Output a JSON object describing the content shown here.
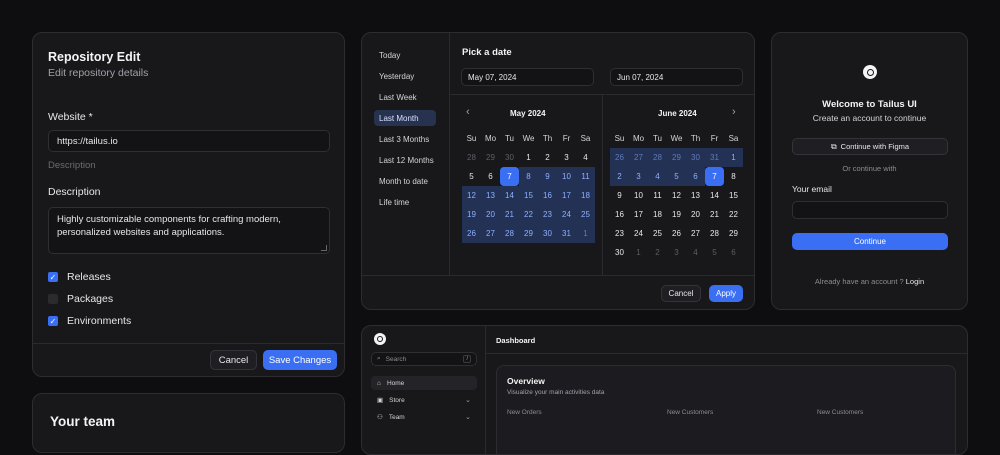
{
  "repo": {
    "title": "Repository Edit",
    "subtitle": "Edit repository details",
    "website_label": "Website *",
    "website_value": "https://tailus.io",
    "website_hint": "Description",
    "description_label": "Description",
    "description_value": "Highly customizable components for crafting modern, personalized websites and applications.",
    "checks": [
      {
        "label": "Releases",
        "checked": true
      },
      {
        "label": "Packages",
        "checked": false
      },
      {
        "label": "Environments",
        "checked": true
      }
    ],
    "cancel_label": "Cancel",
    "save_label": "Save Changes"
  },
  "team": {
    "title": "Your team"
  },
  "datepicker": {
    "presets": [
      "Today",
      "Yesterday",
      "Last Week",
      "Last Month",
      "Last 3 Months",
      "Last 12 Months",
      "Month to date",
      "Life time"
    ],
    "active_preset": "Last Month",
    "title": "Pick a date",
    "start_date": "May 07, 2024",
    "end_date": "Jun 07, 2024",
    "weekdays": [
      "Su",
      "Mo",
      "Tu",
      "We",
      "Th",
      "Fr",
      "Sa"
    ],
    "months": [
      {
        "name": "May 2024",
        "weeks": [
          [
            [
              "28",
              "o"
            ],
            [
              "29",
              "o"
            ],
            [
              "30",
              "o"
            ],
            [
              "1",
              ""
            ],
            [
              "2",
              ""
            ],
            [
              "3",
              ""
            ],
            [
              "4",
              ""
            ]
          ],
          [
            [
              "5",
              ""
            ],
            [
              "6",
              ""
            ],
            [
              "7",
              "s"
            ],
            [
              "8",
              "r"
            ],
            [
              "9",
              "r"
            ],
            [
              "10",
              "r"
            ],
            [
              "11",
              "r"
            ]
          ],
          [
            [
              "12",
              "r"
            ],
            [
              "13",
              "r"
            ],
            [
              "14",
              "r"
            ],
            [
              "15",
              "r"
            ],
            [
              "16",
              "r"
            ],
            [
              "17",
              "r"
            ],
            [
              "18",
              "r"
            ]
          ],
          [
            [
              "19",
              "r"
            ],
            [
              "20",
              "r"
            ],
            [
              "21",
              "r"
            ],
            [
              "22",
              "r"
            ],
            [
              "23",
              "r"
            ],
            [
              "24",
              "r"
            ],
            [
              "25",
              "r"
            ]
          ],
          [
            [
              "26",
              "r"
            ],
            [
              "27",
              "r"
            ],
            [
              "28",
              "r"
            ],
            [
              "29",
              "r"
            ],
            [
              "30",
              "r"
            ],
            [
              "31",
              "r"
            ],
            [
              "1",
              "ro"
            ]
          ]
        ]
      },
      {
        "name": "June 2024",
        "weeks": [
          [
            [
              "26",
              "ro"
            ],
            [
              "27",
              "ro"
            ],
            [
              "28",
              "ro"
            ],
            [
              "29",
              "ro"
            ],
            [
              "30",
              "ro"
            ],
            [
              "31",
              "ro"
            ],
            [
              "1",
              "r"
            ]
          ],
          [
            [
              "2",
              "r"
            ],
            [
              "3",
              "r"
            ],
            [
              "4",
              "r"
            ],
            [
              "5",
              "r"
            ],
            [
              "6",
              "r"
            ],
            [
              "7",
              "s"
            ],
            [
              "8",
              ""
            ]
          ],
          [
            [
              "9",
              ""
            ],
            [
              "10",
              ""
            ],
            [
              "11",
              ""
            ],
            [
              "12",
              ""
            ],
            [
              "13",
              ""
            ],
            [
              "14",
              ""
            ],
            [
              "15",
              ""
            ]
          ],
          [
            [
              "16",
              ""
            ],
            [
              "17",
              ""
            ],
            [
              "18",
              ""
            ],
            [
              "19",
              ""
            ],
            [
              "20",
              ""
            ],
            [
              "21",
              ""
            ],
            [
              "22",
              ""
            ]
          ],
          [
            [
              "23",
              ""
            ],
            [
              "24",
              ""
            ],
            [
              "25",
              ""
            ],
            [
              "26",
              ""
            ],
            [
              "27",
              ""
            ],
            [
              "28",
              ""
            ],
            [
              "29",
              ""
            ]
          ],
          [
            [
              "30",
              ""
            ],
            [
              "1",
              "o"
            ],
            [
              "2",
              "o"
            ],
            [
              "3",
              "o"
            ],
            [
              "4",
              "o"
            ],
            [
              "5",
              "o"
            ],
            [
              "6",
              "o"
            ]
          ]
        ]
      }
    ],
    "cancel_label": "Cancel",
    "apply_label": "Apply"
  },
  "signup": {
    "title": "Welcome to Tailus UI",
    "subtitle": "Create an account to continue",
    "figma_label": "Continue with Figma",
    "divider_label": "Or continue with",
    "email_label": "Your email",
    "email_value": "",
    "continue_label": "Continue",
    "footer_text": "Already have an account ?",
    "login_label": "Login"
  },
  "dashboard": {
    "search_placeholder": "Search",
    "search_shortcut": "/",
    "nav": [
      {
        "label": "Home",
        "icon": "home-icon"
      },
      {
        "label": "Store",
        "icon": "store-icon"
      },
      {
        "label": "Team",
        "icon": "team-icon"
      }
    ],
    "header_title": "Dashboard",
    "overview_title": "Overview",
    "overview_subtitle": "Visualize your main activities data",
    "stats": [
      "New Orders",
      "New Customers",
      "New Customers"
    ]
  },
  "colors": {
    "accent": "#3b6ff3",
    "background": "#0e0e10",
    "card": "#18181b"
  }
}
